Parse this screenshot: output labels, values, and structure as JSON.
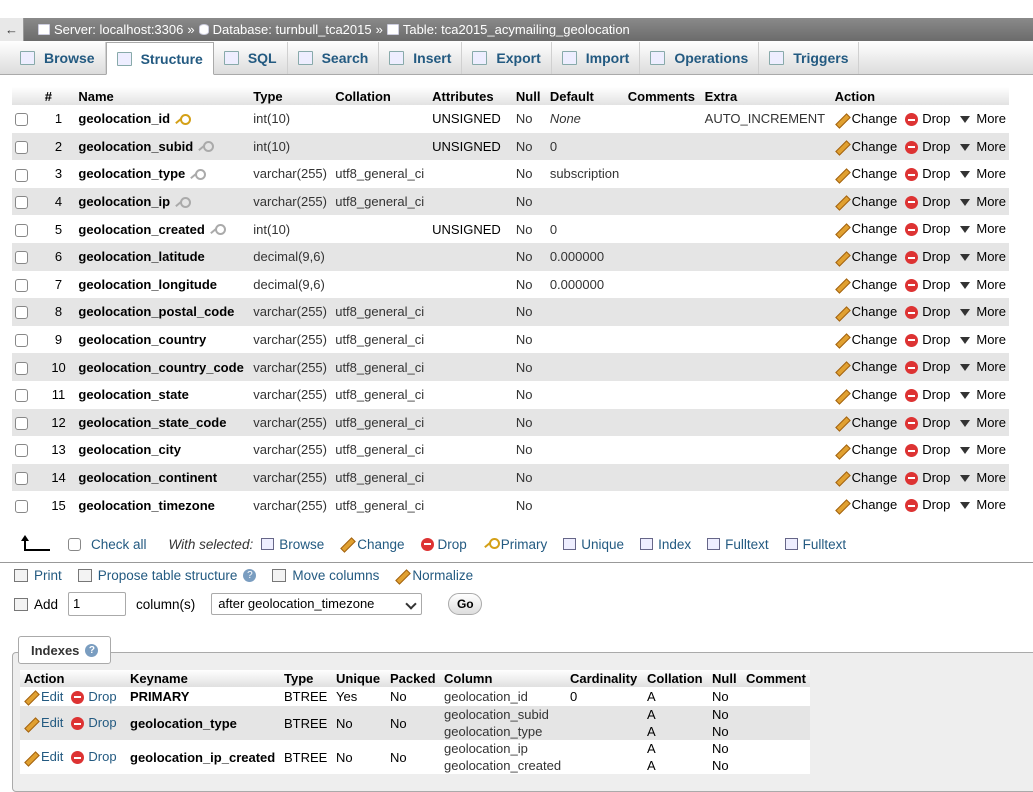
{
  "breadcrumb": {
    "back": "←",
    "server": "Server: localhost:3306",
    "database": "Database: turnbull_tca2015",
    "table": "Table: tca2015_acymailing_geolocation",
    "separator": "»"
  },
  "tabs": [
    {
      "label": "Browse",
      "icon": "browse-icon"
    },
    {
      "label": "Structure",
      "icon": "structure-icon",
      "active": true
    },
    {
      "label": "SQL",
      "icon": "sql-icon"
    },
    {
      "label": "Search",
      "icon": "search-icon"
    },
    {
      "label": "Insert",
      "icon": "insert-icon"
    },
    {
      "label": "Export",
      "icon": "export-icon"
    },
    {
      "label": "Import",
      "icon": "import-icon"
    },
    {
      "label": "Operations",
      "icon": "wrench-icon"
    },
    {
      "label": "Triggers",
      "icon": "triggers-icon"
    }
  ],
  "structure": {
    "headers": [
      "#",
      "Name",
      "Type",
      "Collation",
      "Attributes",
      "Null",
      "Default",
      "Comments",
      "Extra",
      "Action"
    ],
    "action_labels": {
      "change": "Change",
      "drop": "Drop",
      "more": "More"
    },
    "rows": [
      {
        "num": "1",
        "name": "geolocation_id",
        "key": "primary",
        "type": "int(10)",
        "collation": "",
        "attributes": "UNSIGNED",
        "null": "No",
        "default": "None",
        "default_italic": true,
        "comments": "",
        "extra": "AUTO_INCREMENT"
      },
      {
        "num": "2",
        "name": "geolocation_subid",
        "key": "index",
        "type": "int(10)",
        "collation": "",
        "attributes": "UNSIGNED",
        "null": "No",
        "default": "0",
        "comments": "",
        "extra": ""
      },
      {
        "num": "3",
        "name": "geolocation_type",
        "key": "index",
        "type": "varchar(255)",
        "collation": "utf8_general_ci",
        "attributes": "",
        "null": "No",
        "default": "subscription",
        "comments": "",
        "extra": ""
      },
      {
        "num": "4",
        "name": "geolocation_ip",
        "key": "index",
        "type": "varchar(255)",
        "collation": "utf8_general_ci",
        "attributes": "",
        "null": "No",
        "default": "",
        "comments": "",
        "extra": ""
      },
      {
        "num": "5",
        "name": "geolocation_created",
        "key": "index",
        "type": "int(10)",
        "collation": "",
        "attributes": "UNSIGNED",
        "null": "No",
        "default": "0",
        "comments": "",
        "extra": ""
      },
      {
        "num": "6",
        "name": "geolocation_latitude",
        "key": "",
        "type": "decimal(9,6)",
        "collation": "",
        "attributes": "",
        "null": "No",
        "default": "0.000000",
        "comments": "",
        "extra": ""
      },
      {
        "num": "7",
        "name": "geolocation_longitude",
        "key": "",
        "type": "decimal(9,6)",
        "collation": "",
        "attributes": "",
        "null": "No",
        "default": "0.000000",
        "comments": "",
        "extra": ""
      },
      {
        "num": "8",
        "name": "geolocation_postal_code",
        "key": "",
        "type": "varchar(255)",
        "collation": "utf8_general_ci",
        "attributes": "",
        "null": "No",
        "default": "",
        "comments": "",
        "extra": ""
      },
      {
        "num": "9",
        "name": "geolocation_country",
        "key": "",
        "type": "varchar(255)",
        "collation": "utf8_general_ci",
        "attributes": "",
        "null": "No",
        "default": "",
        "comments": "",
        "extra": ""
      },
      {
        "num": "10",
        "name": "geolocation_country_code",
        "key": "",
        "type": "varchar(255)",
        "collation": "utf8_general_ci",
        "attributes": "",
        "null": "No",
        "default": "",
        "comments": "",
        "extra": ""
      },
      {
        "num": "11",
        "name": "geolocation_state",
        "key": "",
        "type": "varchar(255)",
        "collation": "utf8_general_ci",
        "attributes": "",
        "null": "No",
        "default": "",
        "comments": "",
        "extra": ""
      },
      {
        "num": "12",
        "name": "geolocation_state_code",
        "key": "",
        "type": "varchar(255)",
        "collation": "utf8_general_ci",
        "attributes": "",
        "null": "No",
        "default": "",
        "comments": "",
        "extra": ""
      },
      {
        "num": "13",
        "name": "geolocation_city",
        "key": "",
        "type": "varchar(255)",
        "collation": "utf8_general_ci",
        "attributes": "",
        "null": "No",
        "default": "",
        "comments": "",
        "extra": ""
      },
      {
        "num": "14",
        "name": "geolocation_continent",
        "key": "",
        "type": "varchar(255)",
        "collation": "utf8_general_ci",
        "attributes": "",
        "null": "No",
        "default": "",
        "comments": "",
        "extra": ""
      },
      {
        "num": "15",
        "name": "geolocation_timezone",
        "key": "",
        "type": "varchar(255)",
        "collation": "utf8_general_ci",
        "attributes": "",
        "null": "No",
        "default": "",
        "comments": "",
        "extra": ""
      }
    ]
  },
  "bulk": {
    "check_all": "Check all",
    "with_selected": "With selected:",
    "actions": [
      "Browse",
      "Change",
      "Drop",
      "Primary",
      "Unique",
      "Index",
      "Fulltext",
      "Fulltext"
    ]
  },
  "tools": {
    "print": "Print",
    "propose": "Propose table structure",
    "help": "?",
    "move": "Move columns",
    "normalize": "Normalize"
  },
  "add": {
    "label": "Add",
    "count": "1",
    "columns_label": "column(s)",
    "position": "after geolocation_timezone",
    "go": "Go"
  },
  "indexes": {
    "title": "Indexes",
    "headers": [
      "Action",
      "Keyname",
      "Type",
      "Unique",
      "Packed",
      "Column",
      "Cardinality",
      "Collation",
      "Null",
      "Comment"
    ],
    "edit_label": "Edit",
    "drop_label": "Drop",
    "rows": [
      {
        "keyname": "PRIMARY",
        "type": "BTREE",
        "unique": "Yes",
        "packed": "No",
        "columns": [
          "geolocation_id"
        ],
        "cardinality": "0",
        "collations": [
          "A"
        ],
        "nulls": [
          "No"
        ],
        "comment": ""
      },
      {
        "keyname": "geolocation_type",
        "type": "BTREE",
        "unique": "No",
        "packed": "No",
        "columns": [
          "geolocation_subid",
          "geolocation_type"
        ],
        "cardinality": "",
        "collations": [
          "A",
          "A"
        ],
        "nulls": [
          "No",
          "No"
        ],
        "comment": ""
      },
      {
        "keyname": "geolocation_ip_created",
        "type": "BTREE",
        "unique": "No",
        "packed": "No",
        "columns": [
          "geolocation_ip",
          "geolocation_created"
        ],
        "cardinality": "",
        "collations": [
          "A",
          "A"
        ],
        "nulls": [
          "No",
          "No"
        ],
        "comment": ""
      }
    ]
  }
}
